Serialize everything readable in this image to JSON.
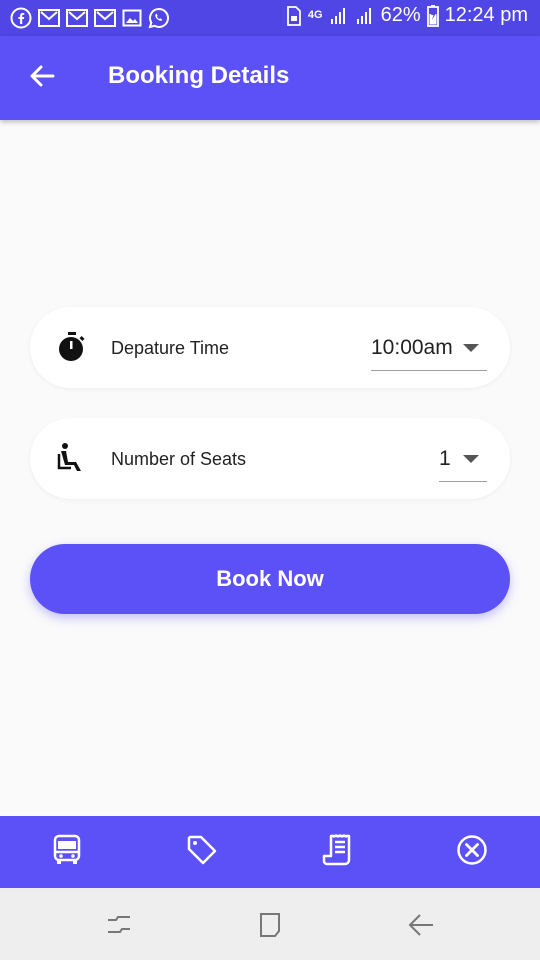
{
  "status_bar": {
    "battery": "62%",
    "time": "12:24 pm",
    "network": "4G"
  },
  "app_bar": {
    "title": "Booking Details"
  },
  "departure": {
    "label": "Depature Time",
    "value": "10:00am"
  },
  "seats": {
    "label": "Number of Seats",
    "value": "1"
  },
  "book_button": {
    "label": "Book Now"
  },
  "bottom_nav": {
    "items": [
      {
        "icon": "bus-icon"
      },
      {
        "icon": "tag-icon"
      },
      {
        "icon": "receipt-icon"
      },
      {
        "icon": "close-circle-icon"
      }
    ]
  },
  "colors": {
    "primary": "#5b51f7",
    "status_bar": "#5046e5",
    "background": "#fafafa"
  }
}
